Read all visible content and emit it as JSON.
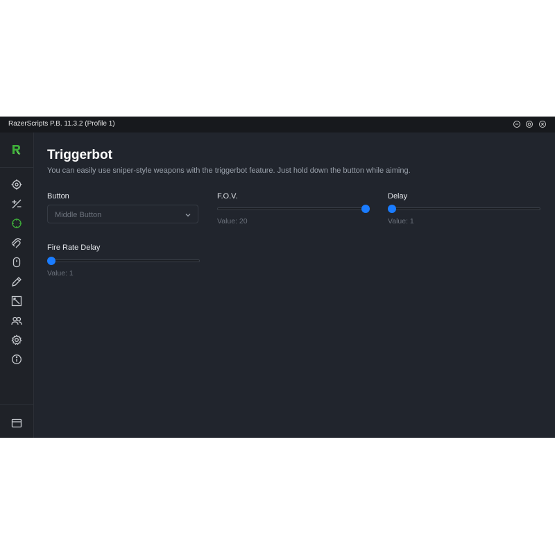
{
  "window": {
    "title": "RazerScripts P.B. 11.3.2 (Profile 1)"
  },
  "titlebar_controls": [
    {
      "name": "minimize-icon"
    },
    {
      "name": "maximize-icon"
    },
    {
      "name": "close-icon"
    }
  ],
  "sidebar": {
    "logo_icon": "razerscripts-logo-icon",
    "active_index": 2,
    "accent_color": "#3fb03a",
    "items": [
      {
        "icon": "crosshair-icon"
      },
      {
        "icon": "plus-minus-icon"
      },
      {
        "icon": "triggerbot-target-icon"
      },
      {
        "icon": "magnet-icon"
      },
      {
        "icon": "mouse-icon"
      },
      {
        "icon": "pen-icon"
      },
      {
        "icon": "resize-window-icon"
      },
      {
        "icon": "users-icon"
      },
      {
        "icon": "gear-icon"
      },
      {
        "icon": "info-icon"
      }
    ],
    "bottom_icon": "window-icon"
  },
  "page": {
    "title": "Triggerbot",
    "description": "You can easily use sniper-style weapons with the triggerbot feature. Just hold down the button while aiming."
  },
  "settings": {
    "button": {
      "label": "Button",
      "value": "Middle Button"
    },
    "fov": {
      "label": "F.O.V.",
      "value_text": "Value: 20",
      "fraction": 1.0
    },
    "delay": {
      "label": "Delay",
      "value_text": "Value: 1",
      "fraction": 0.0
    },
    "fire_rate_delay": {
      "label": "Fire Rate Delay",
      "value_text": "Value: 1",
      "fraction": 0.0
    }
  },
  "colors": {
    "slider_accent": "#1a7cff",
    "background": "#21252d"
  }
}
